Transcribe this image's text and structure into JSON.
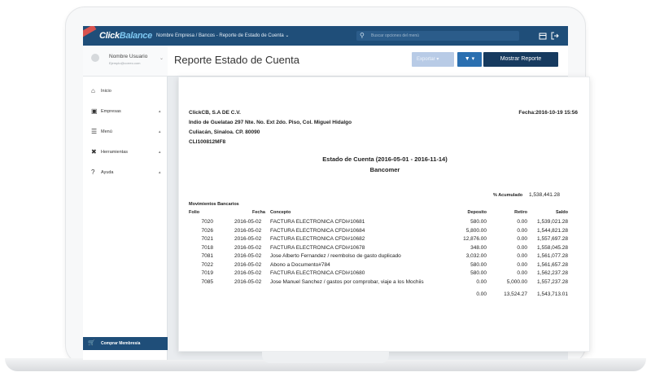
{
  "app": {
    "logo_left": "Click",
    "logo_right": "Balance",
    "breadcrumb": "Nombre Empresa / Bancos - Reporte de Estado de Cuenta ⌄",
    "search_placeholder": "Buscar opciones del menú",
    "icons": [
      "search-icon",
      "calendar-icon",
      "logout-icon"
    ],
    "accent": "#1f4e79"
  },
  "sidebar": {
    "user_name": "Nombre Usuario",
    "user_email": "Ejemplo@correo.com",
    "items": [
      {
        "label": "Inicio",
        "icon": "home-icon",
        "caret": ""
      },
      {
        "label": "Empresas",
        "icon": "briefcase-icon",
        "caret": "▲"
      },
      {
        "label": "Menú",
        "icon": "menu-icon",
        "caret": "▲"
      },
      {
        "label": "Herramientas",
        "icon": "tools-icon",
        "caret": "▲"
      },
      {
        "label": "Ayuda",
        "icon": "help-icon",
        "caret": "▲"
      }
    ],
    "buy_label": "Comprar Membresía"
  },
  "header": {
    "title": "Reporte Estado de Cuenta",
    "export_label": "Exportar ▾",
    "filter_label": "▼ ▾",
    "show_label": "Mostrar Reporte"
  },
  "report": {
    "company": "ClickCB, S.A DE C.V.",
    "address1": "Indio de Guelatao 297 Nte. No. Ext 2do. Piso, Col. Miguel Hidalgo",
    "address2": "Culiacán, Sinaloa. CP. 80090",
    "rfc": "CLI100812MF8",
    "date": "Fecha:2016-10-19 15:56",
    "statement_title": "Estado de Cuenta (2016-05-01 - 2016-11-14)",
    "bank": "Bancomer",
    "acumulado_label": "% Acumulado",
    "acumulado_value": "1,538,441.28",
    "section": "Movimientos Bancarios",
    "columns": [
      "Folio",
      "Fecha",
      "Concepto",
      "Deposito",
      "Retiro",
      "Saldo"
    ],
    "rows": [
      {
        "folio": "7020",
        "fecha": "2016-05-02",
        "concepto": "FACTURA ELECTRONICA CFDI#10681",
        "deposito": "580.00",
        "retiro": "0.00",
        "saldo": "1,539,021.28"
      },
      {
        "folio": "7026",
        "fecha": "2016-05-02",
        "concepto": "FACTURA ELECTRONICA CFDI#10684",
        "deposito": "5,800.00",
        "retiro": "0.00",
        "saldo": "1,544,821.28"
      },
      {
        "folio": "7021",
        "fecha": "2016-05-02",
        "concepto": "FACTURA ELECTRONICA CFDI#10682",
        "deposito": "12,876.00",
        "retiro": "0.00",
        "saldo": "1,557,697.28"
      },
      {
        "folio": "7018",
        "fecha": "2016-05-02",
        "concepto": "FACTURA ELECTRONICA CFDI#10678",
        "deposito": "348.00",
        "retiro": "0.00",
        "saldo": "1,558,045.28"
      },
      {
        "folio": "7081",
        "fecha": "2016-05-02",
        "concepto": "Jose Alberto Fernandez / reembolso de gasto duplicado",
        "deposito": "3,032.00",
        "retiro": "0.00",
        "saldo": "1,561,077.28"
      },
      {
        "folio": "7022",
        "fecha": "2016-05-02",
        "concepto": "Abono a Documento#784",
        "deposito": "580.00",
        "retiro": "0.00",
        "saldo": "1,561,657.28"
      },
      {
        "folio": "7019",
        "fecha": "2016-05-02",
        "concepto": "FACTURA ELECTRONICA CFDI#10680",
        "deposito": "580.00",
        "retiro": "0.00",
        "saldo": "1,562,237.28"
      },
      {
        "folio": "7085",
        "fecha": "2016-05-02",
        "concepto": "Jose Manuel Sanchez / gastos por comprobar, viaje a los Mochiis",
        "deposito": "0.00",
        "retiro": "5,000.00",
        "saldo": "1,557,237.28"
      }
    ],
    "totals": {
      "deposito": "0.00",
      "retiro": "13,524.27",
      "saldo": "1,543,713.01"
    }
  }
}
